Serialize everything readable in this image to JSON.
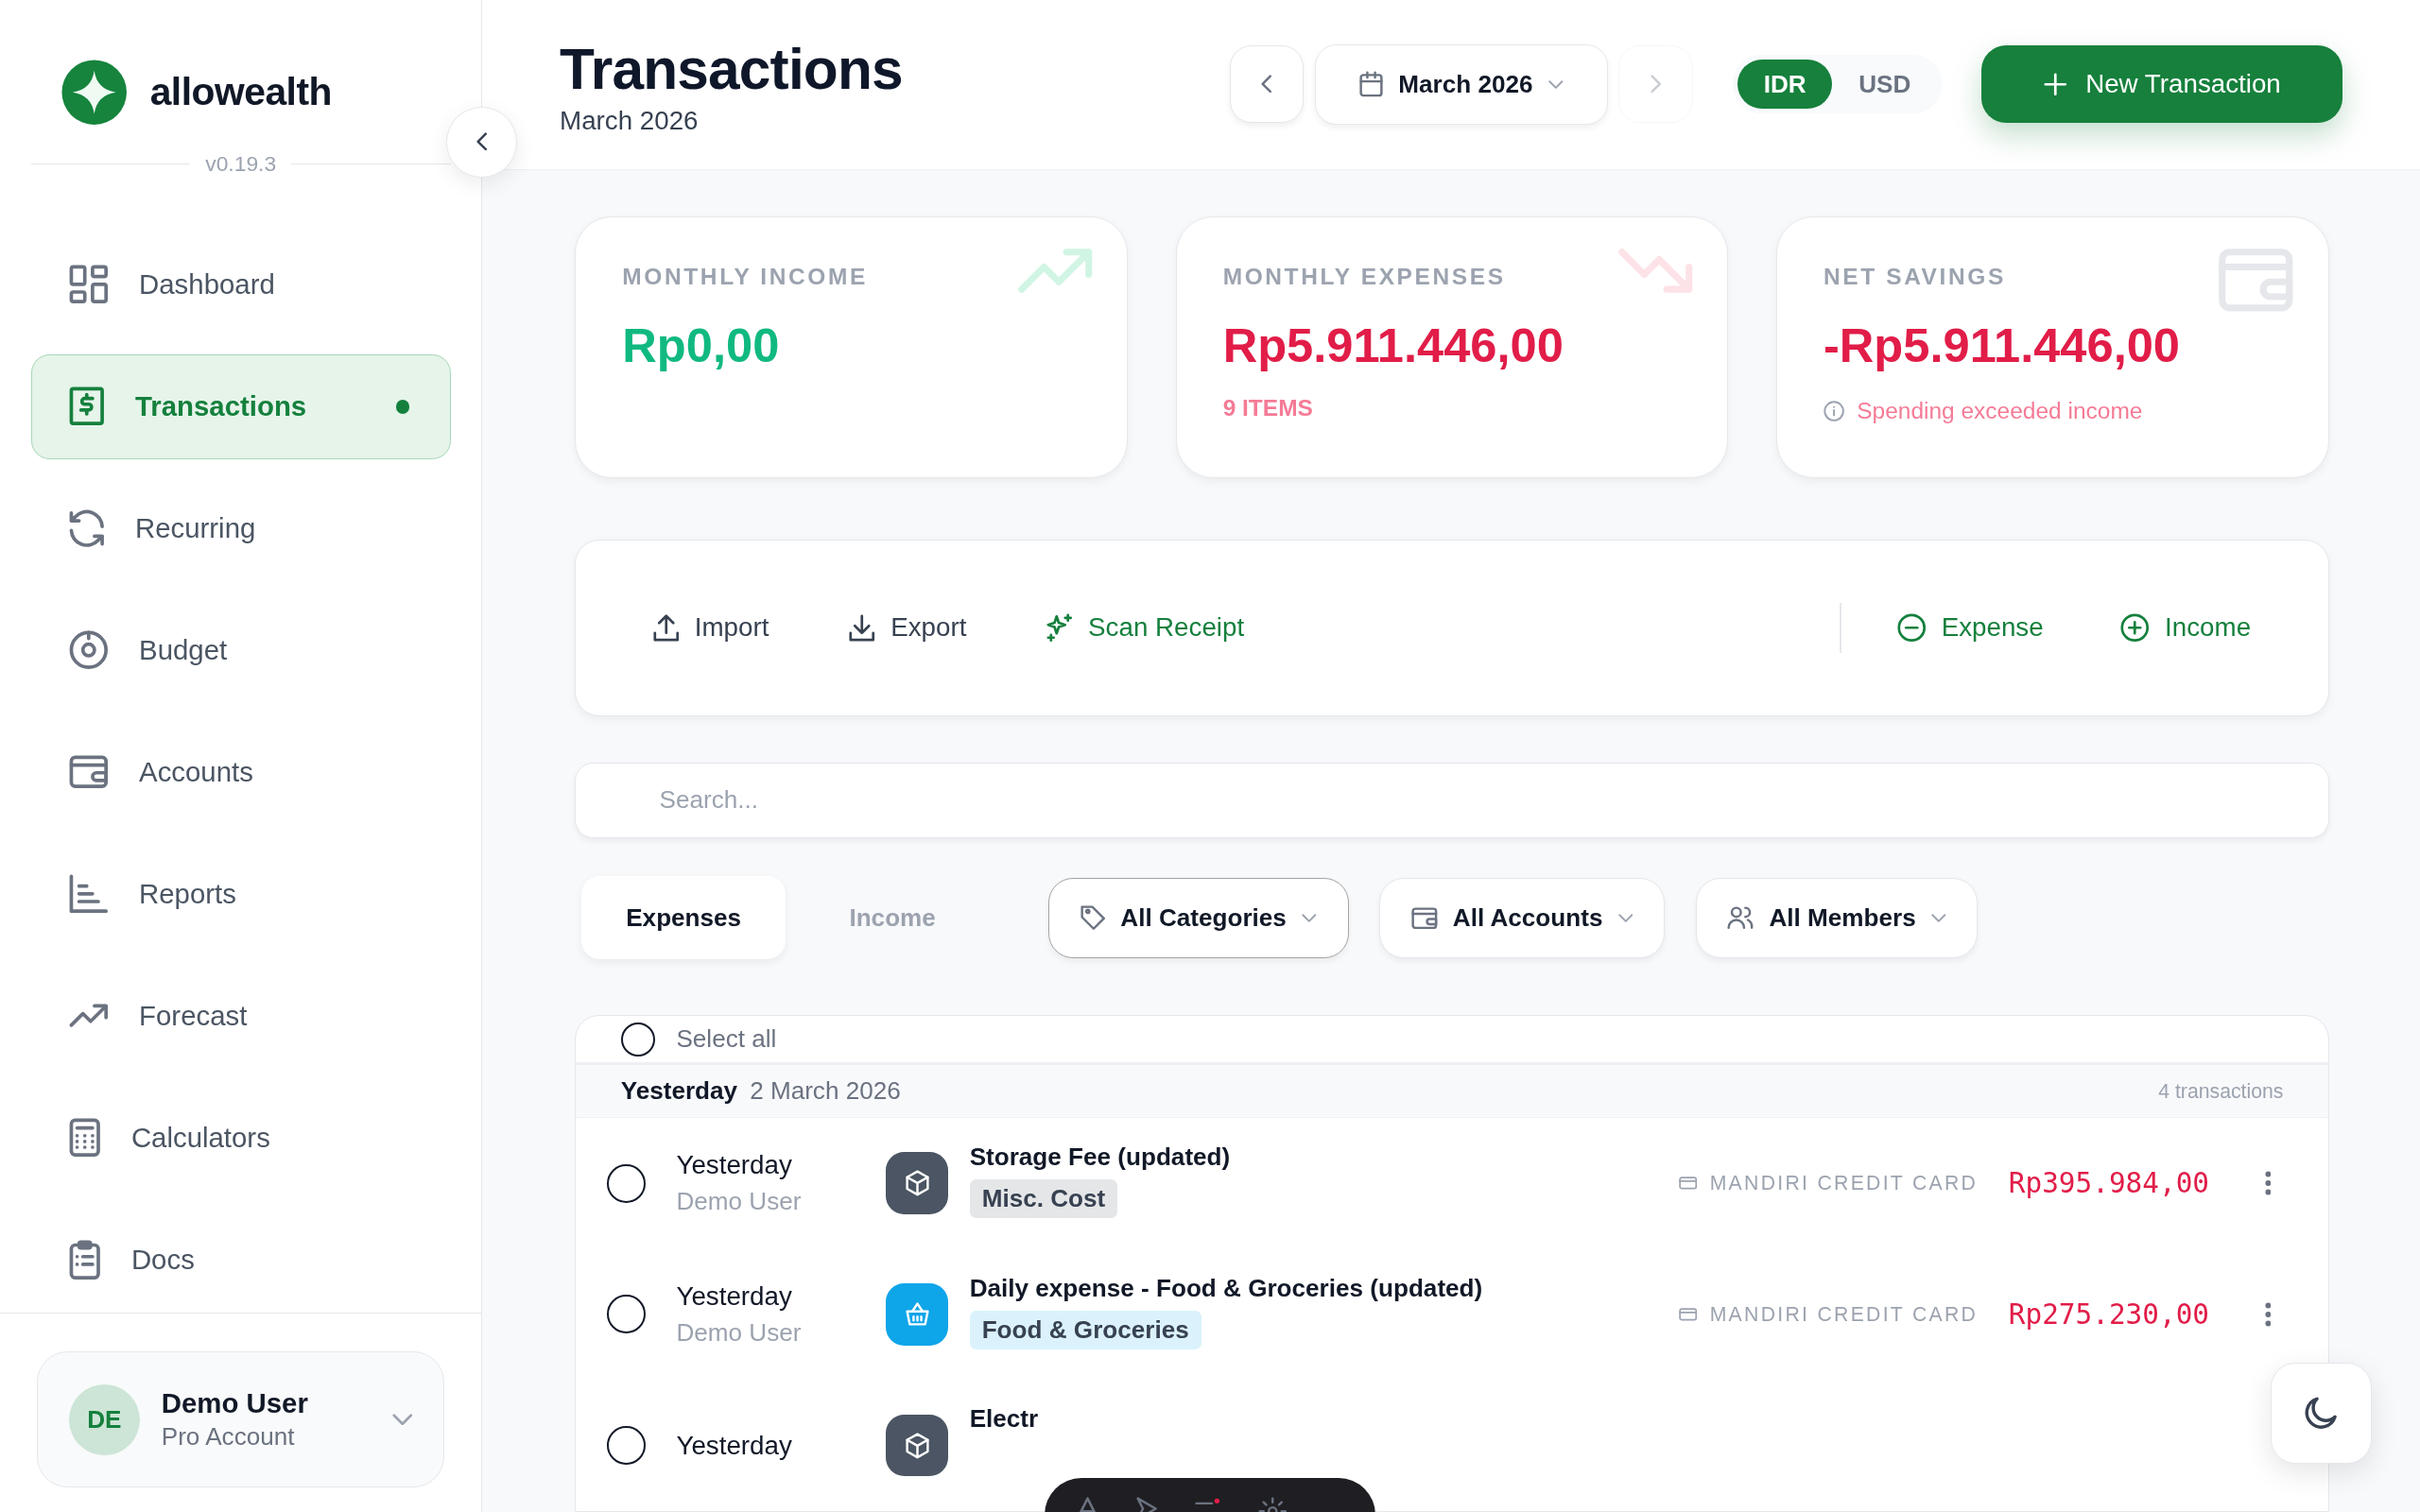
{
  "sidebar": {
    "logo": "allowealth",
    "version": "v0.19.3",
    "items": [
      {
        "label": "Dashboard",
        "selected": false
      },
      {
        "label": "Transactions",
        "selected": true
      },
      {
        "label": "Recurring",
        "selected": false
      },
      {
        "label": "Budget",
        "selected": false
      },
      {
        "label": "Accounts",
        "selected": false
      },
      {
        "label": "Reports",
        "selected": false
      },
      {
        "label": "Forecast",
        "selected": false
      },
      {
        "label": "Calculators",
        "selected": false
      },
      {
        "label": "Docs",
        "selected": false
      }
    ],
    "user": {
      "initials": "DE",
      "name": "Demo User",
      "plan": "Pro Account"
    }
  },
  "header": {
    "title": "Transactions",
    "subtitle": "March 2026",
    "month": "March 2026",
    "next_disabled": true,
    "currencies": [
      {
        "label": "IDR",
        "selected": true
      },
      {
        "label": "USD",
        "selected": false
      }
    ],
    "primary_button": "New Transaction"
  },
  "summary_cards": [
    {
      "kind": "income",
      "label": "MONTHLY INCOME",
      "value": "Rp0,00"
    },
    {
      "kind": "expense",
      "label": "MONTHLY EXPENSES",
      "value": "Rp5.911.446,00",
      "note": "9 ITEMS"
    },
    {
      "kind": "net",
      "label": "NET SAVINGS",
      "value": "-Rp5.911.446,00",
      "note": "Spending exceeded income"
    }
  ],
  "actions": [
    {
      "kind": "import",
      "label": "Import"
    },
    {
      "kind": "export",
      "label": "Export"
    },
    {
      "kind": "scan",
      "label": "Scan Receipt"
    },
    {
      "kind": "expense",
      "label": "Expense"
    },
    {
      "kind": "income",
      "label": "Income"
    }
  ],
  "search": {
    "placeholder": "Search..."
  },
  "type_tabs": [
    {
      "label": "Expenses",
      "selected": true
    },
    {
      "label": "Income",
      "selected": false
    }
  ],
  "filters": [
    {
      "kind": "category",
      "label": "All Categories",
      "selected": true
    },
    {
      "kind": "account",
      "label": "All Accounts",
      "selected": false
    },
    {
      "kind": "member",
      "label": "All Members",
      "selected": false
    }
  ],
  "list": {
    "select_all": {
      "label": "Select all",
      "checked": false
    },
    "groups": [
      {
        "day": "Yesterday",
        "date": "2 March 2026",
        "count": "4 transactions",
        "rows": [
          {
            "kind": "box",
            "checked": false,
            "date": "Yesterday",
            "user": "Demo User",
            "title": "Storage Fee (updated)",
            "category": "Misc. Cost",
            "color": "#4b5563",
            "account": "MANDIRI CREDIT CARD",
            "amount": "Rp395.984,00"
          },
          {
            "kind": "basket",
            "checked": false,
            "date": "Yesterday",
            "user": "Demo User",
            "title": "Daily expense - Food & Groceries (updated)",
            "category": "Food & Groceries",
            "color": "#0ea5e9",
            "account": "MANDIRI CREDIT CARD",
            "amount": "Rp275.230,00"
          },
          {
            "kind": "box",
            "checked": false,
            "date": "Yesterday",
            "title": "Electr",
            "color": "#4b5563"
          }
        ]
      }
    ]
  }
}
